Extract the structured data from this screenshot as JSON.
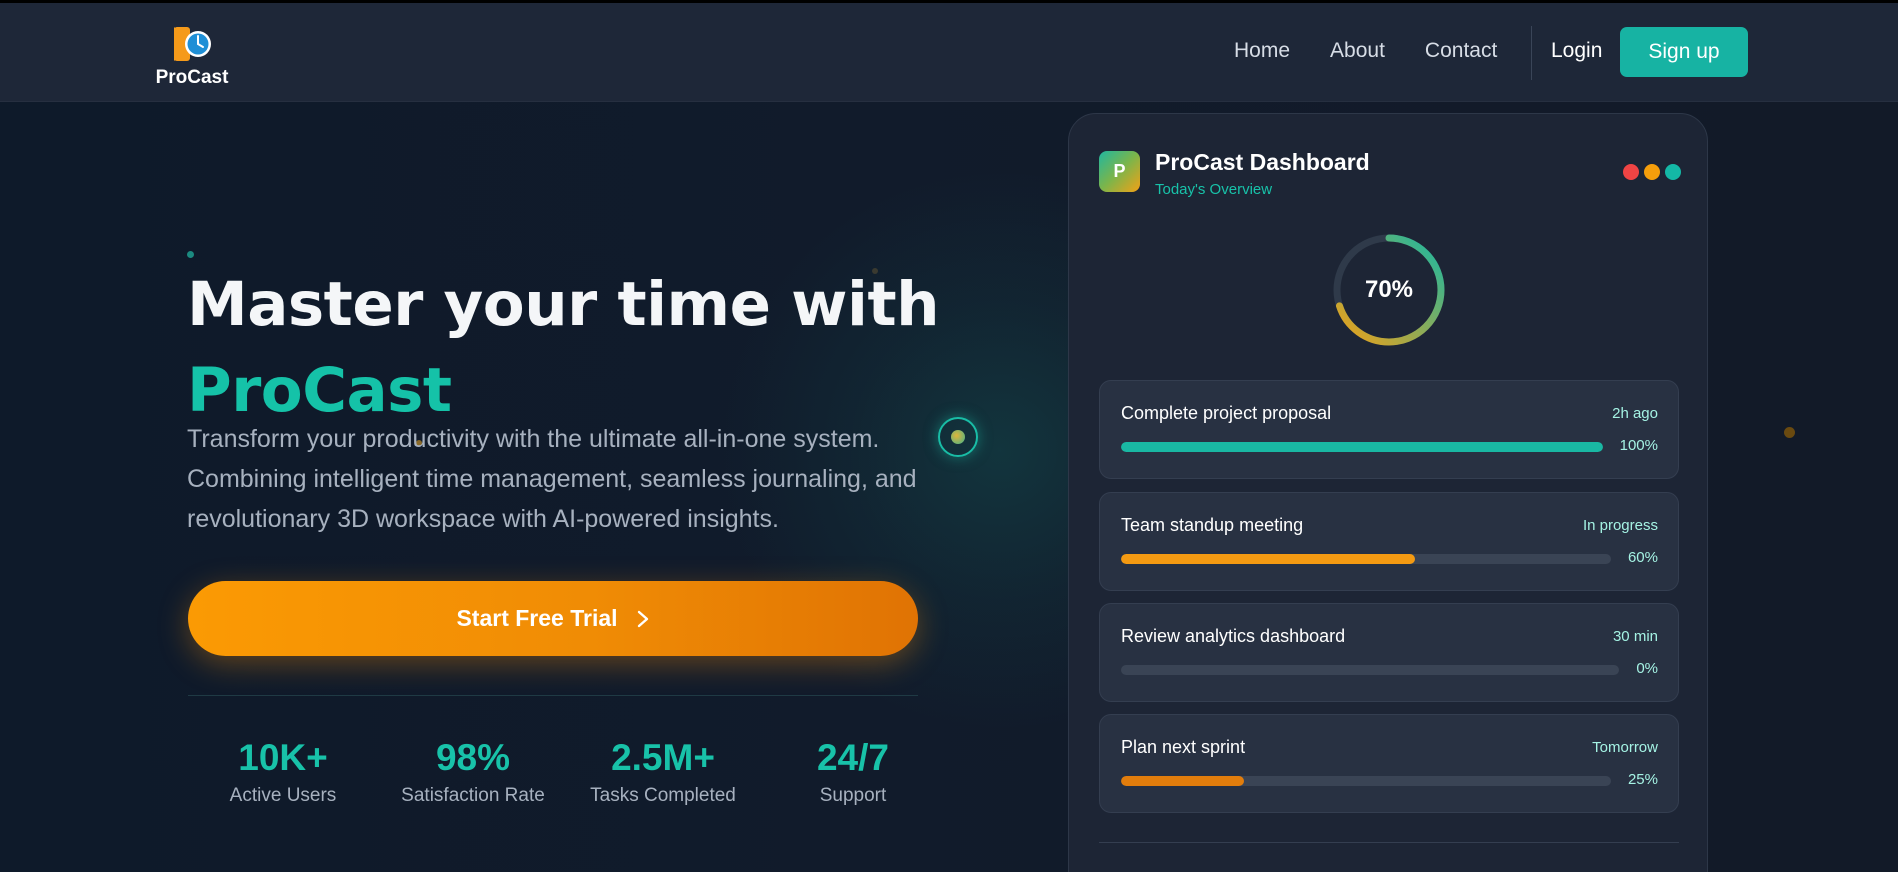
{
  "nav": {
    "brand": "ProCast",
    "links": [
      "Home",
      "About",
      "Contact"
    ],
    "login": "Login",
    "signup": "Sign up"
  },
  "hero": {
    "title_line1": "Master your time with",
    "title_accent": "ProCast",
    "subtitle": "Transform your productivity with the ultimate all-in-one system. Combining intelligent time management, seamless journaling, and revolutionary 3D workspace with AI-powered insights.",
    "cta_label": "Start Free Trial",
    "cta_icon": "chevron-right-icon",
    "stats": [
      {
        "value": "10K+",
        "label": "Active Users"
      },
      {
        "value": "98%",
        "label": "Satisfaction Rate"
      },
      {
        "value": "2.5M+",
        "label": "Tasks Completed"
      },
      {
        "value": "24/7",
        "label": "Support"
      }
    ]
  },
  "dashboard": {
    "logo_letter": "P",
    "title": "ProCast Dashboard",
    "subtitle": "Today's Overview",
    "window_dots": [
      "#ef4444",
      "#f59e0b",
      "#14b8a6"
    ],
    "progress_percent": 70,
    "progress_label": "70%",
    "tasks": [
      {
        "name": "Complete project proposal",
        "meta": "2h ago",
        "percent": 100,
        "percent_label": "100%",
        "color": "#19b8a3"
      },
      {
        "name": "Team standup meeting",
        "meta": "In progress",
        "percent": 60,
        "percent_label": "60%",
        "color": "#f49a12"
      },
      {
        "name": "Review analytics dashboard",
        "meta": "30 min",
        "percent": 0,
        "percent_label": "0%",
        "color": "#19b8a3"
      },
      {
        "name": "Plan next sprint",
        "meta": "Tomorrow",
        "percent": 25,
        "percent_label": "25%",
        "color": "#e27d0c"
      }
    ]
  },
  "colors": {
    "accent": "#15c2a8",
    "cta": "#f7930a",
    "background": "#0f1724"
  }
}
